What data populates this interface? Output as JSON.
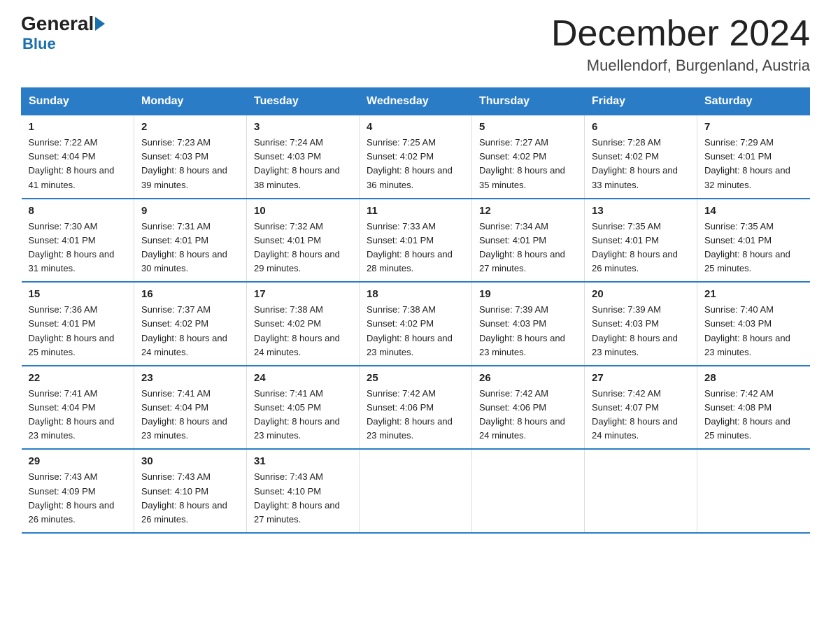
{
  "header": {
    "logo_general": "General",
    "logo_blue": "Blue",
    "month_title": "December 2024",
    "location": "Muellendorf, Burgenland, Austria"
  },
  "days_of_week": [
    "Sunday",
    "Monday",
    "Tuesday",
    "Wednesday",
    "Thursday",
    "Friday",
    "Saturday"
  ],
  "weeks": [
    [
      {
        "day": "1",
        "sunrise": "7:22 AM",
        "sunset": "4:04 PM",
        "daylight": "8 hours and 41 minutes."
      },
      {
        "day": "2",
        "sunrise": "7:23 AM",
        "sunset": "4:03 PM",
        "daylight": "8 hours and 39 minutes."
      },
      {
        "day": "3",
        "sunrise": "7:24 AM",
        "sunset": "4:03 PM",
        "daylight": "8 hours and 38 minutes."
      },
      {
        "day": "4",
        "sunrise": "7:25 AM",
        "sunset": "4:02 PM",
        "daylight": "8 hours and 36 minutes."
      },
      {
        "day": "5",
        "sunrise": "7:27 AM",
        "sunset": "4:02 PM",
        "daylight": "8 hours and 35 minutes."
      },
      {
        "day": "6",
        "sunrise": "7:28 AM",
        "sunset": "4:02 PM",
        "daylight": "8 hours and 33 minutes."
      },
      {
        "day": "7",
        "sunrise": "7:29 AM",
        "sunset": "4:01 PM",
        "daylight": "8 hours and 32 minutes."
      }
    ],
    [
      {
        "day": "8",
        "sunrise": "7:30 AM",
        "sunset": "4:01 PM",
        "daylight": "8 hours and 31 minutes."
      },
      {
        "day": "9",
        "sunrise": "7:31 AM",
        "sunset": "4:01 PM",
        "daylight": "8 hours and 30 minutes."
      },
      {
        "day": "10",
        "sunrise": "7:32 AM",
        "sunset": "4:01 PM",
        "daylight": "8 hours and 29 minutes."
      },
      {
        "day": "11",
        "sunrise": "7:33 AM",
        "sunset": "4:01 PM",
        "daylight": "8 hours and 28 minutes."
      },
      {
        "day": "12",
        "sunrise": "7:34 AM",
        "sunset": "4:01 PM",
        "daylight": "8 hours and 27 minutes."
      },
      {
        "day": "13",
        "sunrise": "7:35 AM",
        "sunset": "4:01 PM",
        "daylight": "8 hours and 26 minutes."
      },
      {
        "day": "14",
        "sunrise": "7:35 AM",
        "sunset": "4:01 PM",
        "daylight": "8 hours and 25 minutes."
      }
    ],
    [
      {
        "day": "15",
        "sunrise": "7:36 AM",
        "sunset": "4:01 PM",
        "daylight": "8 hours and 25 minutes."
      },
      {
        "day": "16",
        "sunrise": "7:37 AM",
        "sunset": "4:02 PM",
        "daylight": "8 hours and 24 minutes."
      },
      {
        "day": "17",
        "sunrise": "7:38 AM",
        "sunset": "4:02 PM",
        "daylight": "8 hours and 24 minutes."
      },
      {
        "day": "18",
        "sunrise": "7:38 AM",
        "sunset": "4:02 PM",
        "daylight": "8 hours and 23 minutes."
      },
      {
        "day": "19",
        "sunrise": "7:39 AM",
        "sunset": "4:03 PM",
        "daylight": "8 hours and 23 minutes."
      },
      {
        "day": "20",
        "sunrise": "7:39 AM",
        "sunset": "4:03 PM",
        "daylight": "8 hours and 23 minutes."
      },
      {
        "day": "21",
        "sunrise": "7:40 AM",
        "sunset": "4:03 PM",
        "daylight": "8 hours and 23 minutes."
      }
    ],
    [
      {
        "day": "22",
        "sunrise": "7:41 AM",
        "sunset": "4:04 PM",
        "daylight": "8 hours and 23 minutes."
      },
      {
        "day": "23",
        "sunrise": "7:41 AM",
        "sunset": "4:04 PM",
        "daylight": "8 hours and 23 minutes."
      },
      {
        "day": "24",
        "sunrise": "7:41 AM",
        "sunset": "4:05 PM",
        "daylight": "8 hours and 23 minutes."
      },
      {
        "day": "25",
        "sunrise": "7:42 AM",
        "sunset": "4:06 PM",
        "daylight": "8 hours and 23 minutes."
      },
      {
        "day": "26",
        "sunrise": "7:42 AM",
        "sunset": "4:06 PM",
        "daylight": "8 hours and 24 minutes."
      },
      {
        "day": "27",
        "sunrise": "7:42 AM",
        "sunset": "4:07 PM",
        "daylight": "8 hours and 24 minutes."
      },
      {
        "day": "28",
        "sunrise": "7:42 AM",
        "sunset": "4:08 PM",
        "daylight": "8 hours and 25 minutes."
      }
    ],
    [
      {
        "day": "29",
        "sunrise": "7:43 AM",
        "sunset": "4:09 PM",
        "daylight": "8 hours and 26 minutes."
      },
      {
        "day": "30",
        "sunrise": "7:43 AM",
        "sunset": "4:10 PM",
        "daylight": "8 hours and 26 minutes."
      },
      {
        "day": "31",
        "sunrise": "7:43 AM",
        "sunset": "4:10 PM",
        "daylight": "8 hours and 27 minutes."
      },
      null,
      null,
      null,
      null
    ]
  ]
}
